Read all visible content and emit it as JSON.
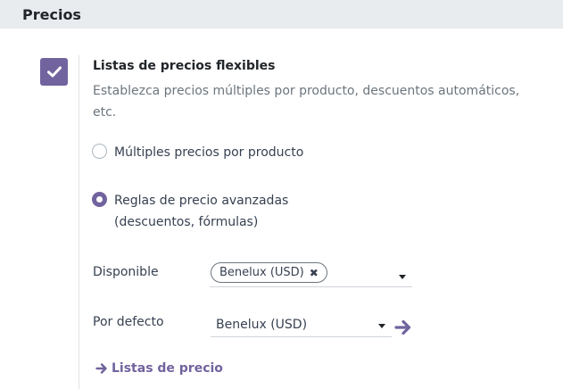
{
  "section": {
    "title": "Precios"
  },
  "setting": {
    "checked": true,
    "title": "Listas de precios flexibles",
    "description": "Establezca precios múltiples por producto, descuentos automáticos, etc."
  },
  "mode": {
    "options": [
      {
        "label": "Múltiples precios por producto",
        "selected": false
      },
      {
        "label": "Reglas de precio avanzadas (descuentos, fórmulas)",
        "selected": true
      }
    ]
  },
  "available": {
    "label": "Disponible",
    "tags": [
      {
        "label": "Benelux (USD)"
      }
    ]
  },
  "default": {
    "label": "Por defecto",
    "value": "Benelux (USD)"
  },
  "link": {
    "label": "Listas de precio"
  },
  "colors": {
    "accent": "#71639e",
    "header_bg": "#e9ecef"
  },
  "icons": {
    "checkbox": "check-icon",
    "tag_remove": "close-icon",
    "dropdown": "caret-down-icon",
    "internal_link": "arrow-right-icon"
  }
}
